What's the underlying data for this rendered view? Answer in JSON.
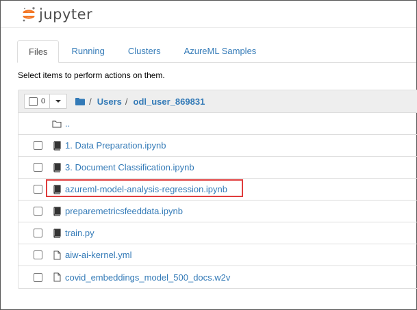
{
  "header": {
    "logo_text": "jupyter"
  },
  "tabs": [
    {
      "label": "Files",
      "active": true
    },
    {
      "label": "Running",
      "active": false
    },
    {
      "label": "Clusters",
      "active": false
    },
    {
      "label": "AzureML Samples",
      "active": false
    }
  ],
  "instruction": "Select items to perform actions on them.",
  "toolbar": {
    "selected_count": "0"
  },
  "breadcrumb": {
    "sep": "/",
    "users": "Users",
    "user": "odl_user_869831"
  },
  "items": [
    {
      "name": "..",
      "type": "folder"
    },
    {
      "name": "1. Data Preparation.ipynb",
      "type": "notebook"
    },
    {
      "name": "3. Document Classification.ipynb",
      "type": "notebook"
    },
    {
      "name": "azureml-model-analysis-regression.ipynb",
      "type": "notebook",
      "highlighted": true
    },
    {
      "name": "preparemetricsfeeddata.ipynb",
      "type": "notebook"
    },
    {
      "name": "train.py",
      "type": "notebook"
    },
    {
      "name": "aiw-ai-kernel.yml",
      "type": "file"
    },
    {
      "name": "covid_embeddings_model_500_docs.w2v",
      "type": "file"
    }
  ],
  "colors": {
    "link": "#337ab7",
    "highlight": "#e03c3c",
    "logo_orange": "#f37726"
  }
}
